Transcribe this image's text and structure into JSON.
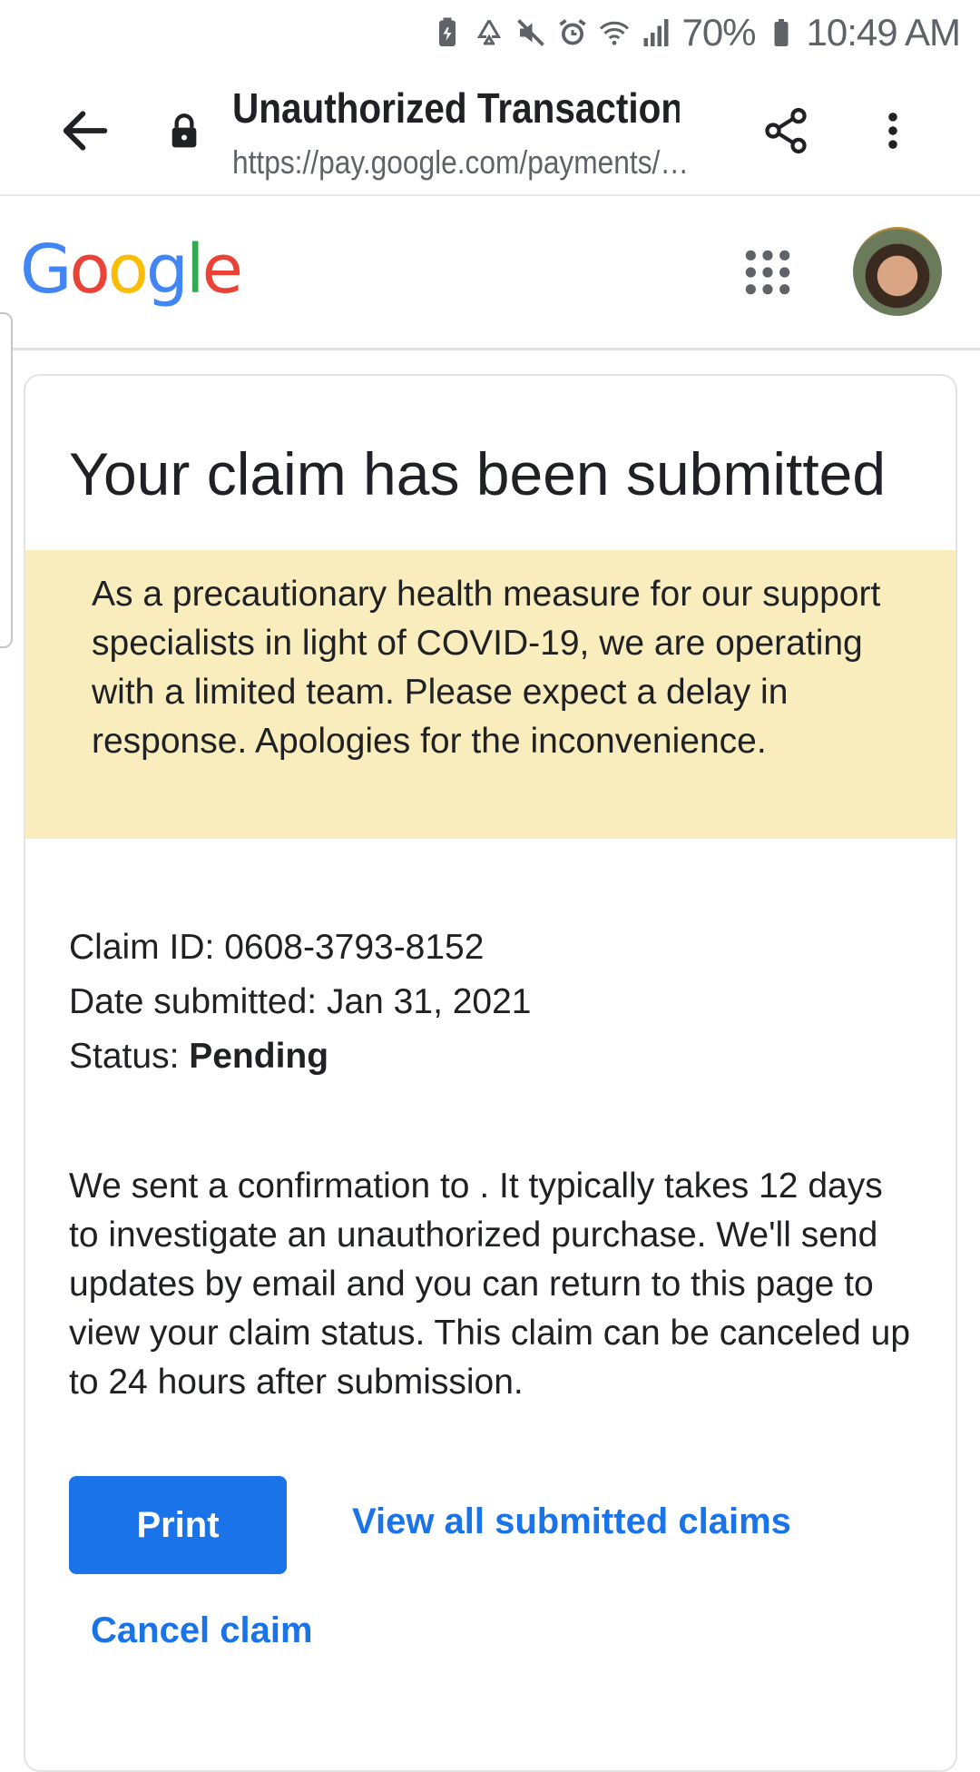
{
  "status_bar": {
    "battery_percent": "70%",
    "time": "10:49 AM",
    "icons": [
      "battery-saver-icon",
      "recycle-icon",
      "mute-icon",
      "alarm-icon",
      "wifi-icon",
      "signal-icon",
      "battery-icon"
    ]
  },
  "browser": {
    "page_title": "Unauthorized Transactions",
    "url": "https://pay.google.com/payments/…",
    "icons": [
      "back-arrow-icon",
      "lock-icon",
      "share-icon",
      "more-vert-icon"
    ]
  },
  "google_header": {
    "logo_letters": [
      "G",
      "o",
      "o",
      "g",
      "l",
      "e"
    ],
    "icons": [
      "apps-grid-icon",
      "avatar"
    ]
  },
  "claim": {
    "title": "Your claim has been submitted",
    "notice": "As a precautionary health measure for our support specialists in light of COVID-19, we are operating with a limited team. Please expect a delay in response. Apologies for the inconvenience.",
    "claim_id_label": "Claim ID: ",
    "claim_id": "0608-3793-8152",
    "date_label": "Date submitted: ",
    "date": "Jan 31, 2021",
    "status_label": "Status: ",
    "status": "Pending",
    "confirmation": "We sent a confirmation to . It typically takes 12 days to investigate an unauthorized purchase. We'll send updates by email and you can return to this page to view your claim status. This claim can be canceled up to 24 hours after submission.",
    "print_label": "Print",
    "view_all_label": "View all submitted claims",
    "cancel_label": "Cancel claim"
  },
  "colors": {
    "accent": "#1a73e8",
    "notice_bg": "#f9edbd",
    "google_blue": "#4285f4",
    "google_red": "#ea4335",
    "google_yellow": "#fbbc05",
    "google_green": "#34a853"
  }
}
